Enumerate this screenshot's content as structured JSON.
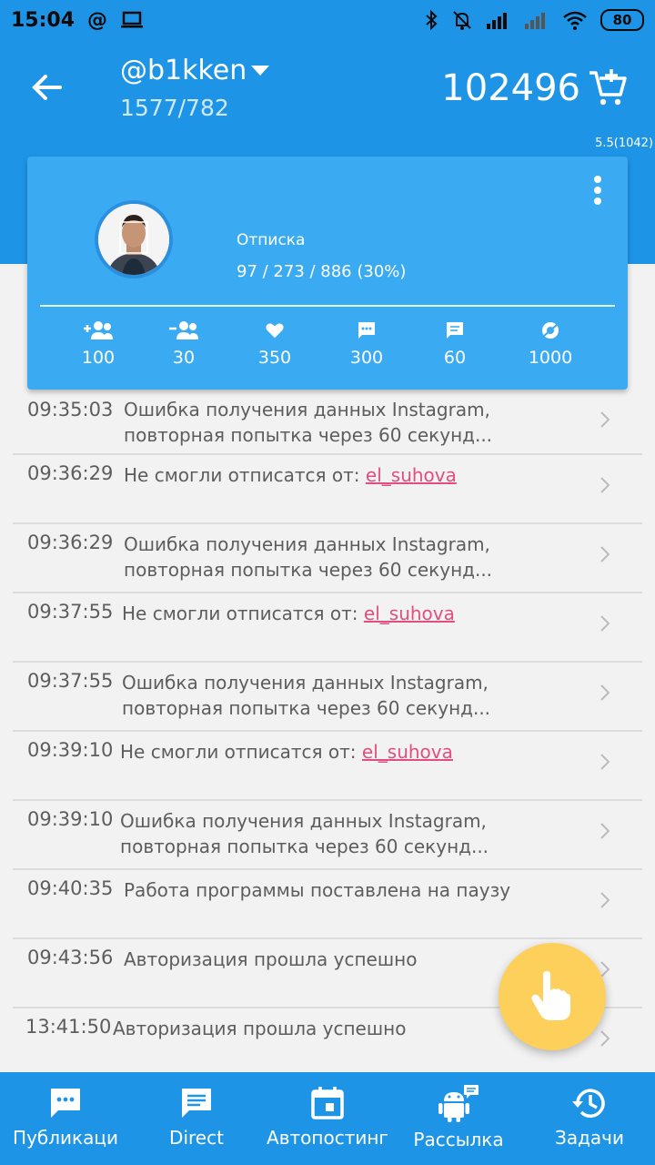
{
  "status_bar": {
    "time": "15:04",
    "battery": "80"
  },
  "header": {
    "account": "@b1kken",
    "stats": "1577/782",
    "balance": "102496",
    "version": "5.5(1042)"
  },
  "task_card": {
    "title": "Отписка",
    "progress": "97 / 273 / 886 (30%)",
    "stats": [
      {
        "icon": "follow-icon",
        "value": "100"
      },
      {
        "icon": "unfollow-icon",
        "value": "30"
      },
      {
        "icon": "heart-icon",
        "value": "350"
      },
      {
        "icon": "comment-icon",
        "value": "300"
      },
      {
        "icon": "message-icon",
        "value": "60"
      },
      {
        "icon": "view-icon",
        "value": "1000"
      }
    ]
  },
  "log": [
    {
      "time": "09:35:03",
      "text": "Ошибка получения данных Instagram, повторная попытка через 60 секунд...",
      "link": ""
    },
    {
      "time": "09:36:29",
      "text": "Не смогли отписатся от: ",
      "link": "el_suhova"
    },
    {
      "time": "09:36:29",
      "text": "Ошибка получения данных Instagram, повторная попытка через 60 секунд...",
      "link": ""
    },
    {
      "time": "09:37:55",
      "text": "Не смогли отписатся от: ",
      "link": "el_suhova"
    },
    {
      "time": "09:37:55",
      "text": "Ошибка получения данных Instagram, повторная попытка через 60 секунд...",
      "link": ""
    },
    {
      "time": "09:39:10",
      "text": "Не смогли отписатся от: ",
      "link": "el_suhova"
    },
    {
      "time": "09:39:10",
      "text": "Ошибка получения данных Instagram, повторная попытка через 60 секунд...",
      "link": ""
    },
    {
      "time": "09:40:35",
      "text": "Работа программы поставлена на паузу",
      "link": ""
    },
    {
      "time": "09:43:56",
      "text": "Авторизация прошла успешно",
      "link": ""
    },
    {
      "time": "13:41:50",
      "text": "Авторизация прошла успешно",
      "link": ""
    }
  ],
  "bottom_nav": [
    {
      "label": "Публикаци",
      "icon": "publications-icon"
    },
    {
      "label": "Direct",
      "icon": "direct-icon"
    },
    {
      "label": "Автопостинг",
      "icon": "calendar-icon"
    },
    {
      "label": "Рассылка",
      "icon": "android-icon"
    },
    {
      "label": "Задачи",
      "icon": "history-icon"
    }
  ],
  "colors": {
    "primary": "#1e94e6",
    "card": "#3aabf2",
    "link": "#e0507e",
    "fab": "#fdd05c"
  }
}
